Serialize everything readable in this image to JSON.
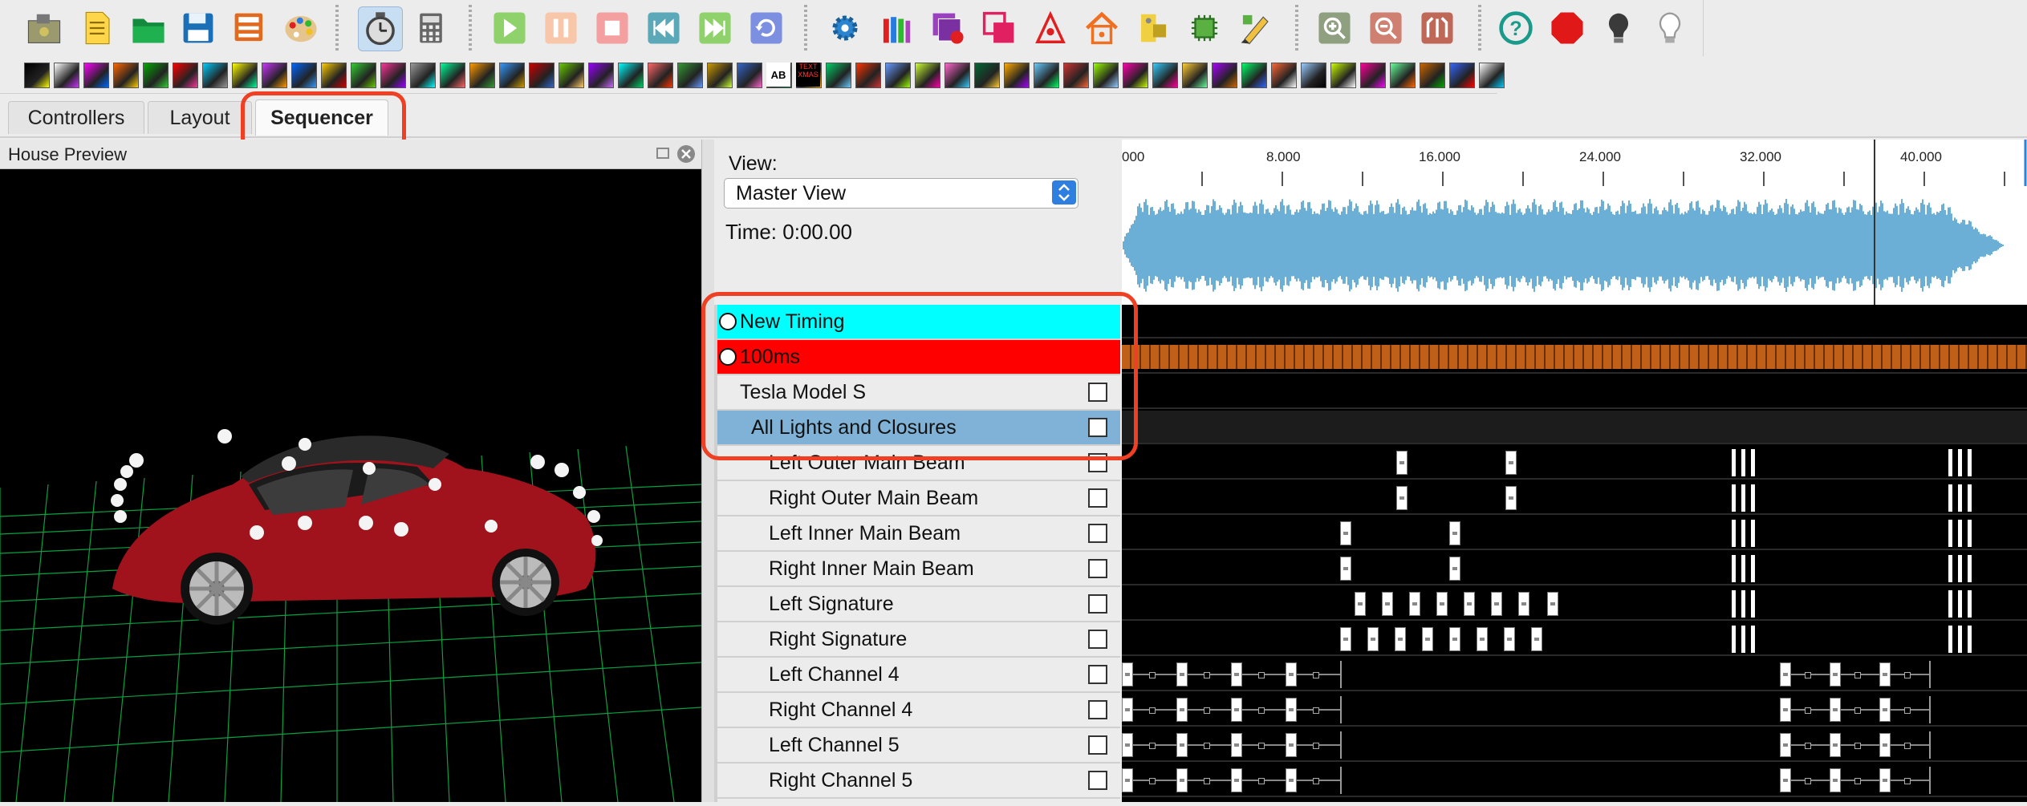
{
  "toolbar": {
    "main_icons": [
      {
        "name": "open-folder-icon"
      },
      {
        "name": "new-document-icon"
      },
      {
        "name": "open-green-folder-icon"
      },
      {
        "name": "save-icon"
      },
      {
        "name": "save-as-icon"
      },
      {
        "name": "palette-icon"
      },
      {
        "name": "clock-icon"
      },
      {
        "name": "calculator-icon"
      },
      {
        "name": "play-icon"
      },
      {
        "name": "pause-icon"
      },
      {
        "name": "stop-icon"
      },
      {
        "name": "rewind-icon"
      },
      {
        "name": "fast-forward-icon"
      },
      {
        "name": "replay-icon"
      },
      {
        "name": "settings-gear-icon"
      },
      {
        "name": "crayons-icon"
      },
      {
        "name": "layers-gear-icon"
      },
      {
        "name": "overlap-squares-icon"
      },
      {
        "name": "triangle-node-icon"
      },
      {
        "name": "house-icon"
      },
      {
        "name": "clipboard-bulb-icon"
      },
      {
        "name": "chip-icon"
      },
      {
        "name": "pencil-edit-icon"
      },
      {
        "name": "zoom-in-icon"
      },
      {
        "name": "zoom-out-icon"
      },
      {
        "name": "sequence-fit-icon"
      },
      {
        "name": "help-icon"
      },
      {
        "name": "stop-sign-icon"
      },
      {
        "name": "lightbulb-off-icon"
      },
      {
        "name": "lightbulb-on-icon"
      }
    ],
    "effect_icon_count": 50,
    "effect_text_labels": [
      "AB",
      "TEXT XMAS"
    ]
  },
  "tabs": {
    "controllers": "Controllers",
    "layout": "Layout",
    "sequencer": "Sequencer"
  },
  "preview": {
    "title": "House Preview"
  },
  "sequencer": {
    "view_label": "View:",
    "view_value": "Master View",
    "time_label": "Time: 0:00.00",
    "rows": [
      {
        "label": "New Timing",
        "type": "timing",
        "color": "#00ffff"
      },
      {
        "label": "100ms",
        "type": "timing",
        "color": "#ff0000"
      },
      {
        "label": "Tesla Model S",
        "type": "model"
      },
      {
        "label": "All Lights and Closures",
        "type": "group"
      },
      {
        "label": "Left Outer Main Beam",
        "type": "channel"
      },
      {
        "label": "Right Outer Main Beam",
        "type": "channel"
      },
      {
        "label": "Left Inner Main Beam",
        "type": "channel"
      },
      {
        "label": "Right Inner Main Beam",
        "type": "channel"
      },
      {
        "label": "Left Signature",
        "type": "channel"
      },
      {
        "label": "Right Signature",
        "type": "channel"
      },
      {
        "label": "Left Channel 4",
        "type": "channel"
      },
      {
        "label": "Right Channel 4",
        "type": "channel"
      },
      {
        "label": "Left Channel 5",
        "type": "channel"
      },
      {
        "label": "Right Channel 5",
        "type": "channel"
      }
    ],
    "ruler_ticks": [
      "000",
      "8.000",
      "16.000",
      "24.000",
      "32.000",
      "40.000"
    ]
  },
  "colors": {
    "accent_highlight": "#f04024",
    "timing_cyan": "#00ffff",
    "timing_red": "#ff0000",
    "group_selected": "#7fb2d6",
    "waveform": "#6baed6",
    "car_body": "#a0121c",
    "grid_green": "#0bb34a"
  }
}
